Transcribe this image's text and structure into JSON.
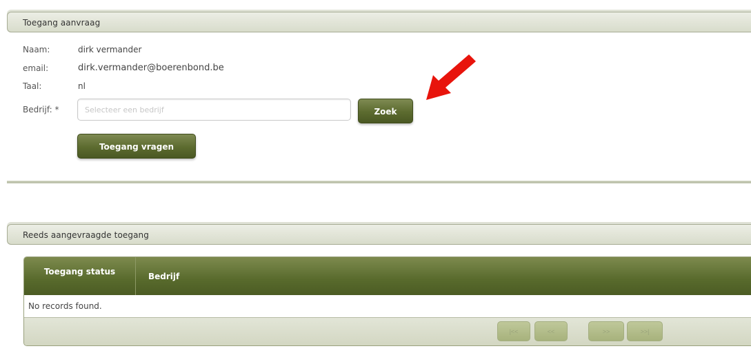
{
  "request_panel": {
    "title": "Toegang aanvraag",
    "name_label": "Naam:",
    "name_value": "dirk vermander",
    "email_label": "email:",
    "email_value": "dirk.vermander@boerenbond.be",
    "language_label": "Taal:",
    "language_value": "nl",
    "company_label": "Bedrijf: *",
    "company_placeholder": "Selecteer een bedrijf",
    "company_value": "",
    "search_button": "Zoek",
    "request_button": "Toegang vragen"
  },
  "requested_panel": {
    "title": "Reeds aangevraagde toegang",
    "columns": [
      "Toegang status",
      "Bedrijf"
    ],
    "empty_message": "No records found.",
    "pager": [
      "|<<",
      "<<",
      ">>",
      ">>|"
    ]
  },
  "annotation": {
    "arrow_icon": "red-arrow-icon",
    "arrow_color": "#e8140c"
  },
  "colors": {
    "button": "#5c6b2f",
    "panel_header": "#dfe2d6",
    "grid_header": "#586a2c"
  }
}
